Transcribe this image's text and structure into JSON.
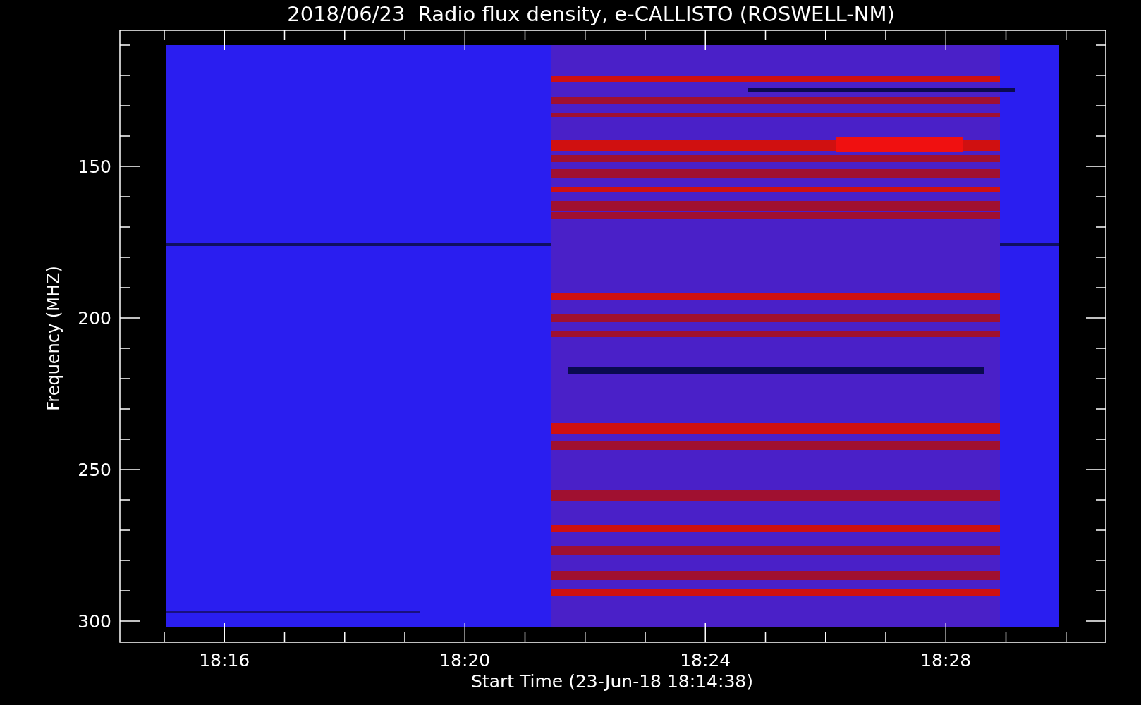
{
  "title": "2018/06/23  Radio flux density, e-CALLISTO (ROSWELL-NM)",
  "ylabel": "Frequency (MHZ)",
  "xlabel": "Start Time (23-Jun-18 18:14:38)",
  "yticks": [
    "150",
    "200",
    "250",
    "300"
  ],
  "xticks": [
    "18:16",
    "18:20",
    "18:24",
    "18:28"
  ]
}
